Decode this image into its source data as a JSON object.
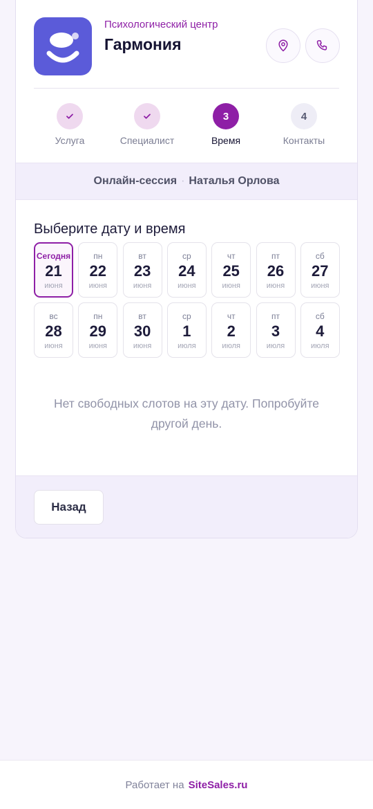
{
  "header": {
    "subtitle": "Психологический центр",
    "title": "Гармония",
    "location_icon": "map-pin-icon",
    "phone_icon": "phone-icon"
  },
  "steps": [
    {
      "label": "Услуга",
      "state": "done"
    },
    {
      "label": "Специалист",
      "state": "done"
    },
    {
      "label": "Время",
      "number": "3",
      "state": "active"
    },
    {
      "label": "Контакты",
      "number": "4",
      "state": "todo"
    }
  ],
  "summary": {
    "service": "Онлайн-сессия",
    "separator": "·",
    "specialist": "Наталья Орлова"
  },
  "section_title": "Выберите дату и время",
  "days": [
    {
      "weekday": "Сегодня",
      "day": "21",
      "month": "июня",
      "selected": true
    },
    {
      "weekday": "пн",
      "day": "22",
      "month": "июня"
    },
    {
      "weekday": "вт",
      "day": "23",
      "month": "июня"
    },
    {
      "weekday": "ср",
      "day": "24",
      "month": "июня"
    },
    {
      "weekday": "чт",
      "day": "25",
      "month": "июня"
    },
    {
      "weekday": "пт",
      "day": "26",
      "month": "июня"
    },
    {
      "weekday": "сб",
      "day": "27",
      "month": "июня"
    },
    {
      "weekday": "вс",
      "day": "28",
      "month": "июня"
    },
    {
      "weekday": "пн",
      "day": "29",
      "month": "июня"
    },
    {
      "weekday": "вт",
      "day": "30",
      "month": "июня"
    },
    {
      "weekday": "ср",
      "day": "1",
      "month": "июля"
    },
    {
      "weekday": "чт",
      "day": "2",
      "month": "июля"
    },
    {
      "weekday": "пт",
      "day": "3",
      "month": "июля"
    },
    {
      "weekday": "сб",
      "day": "4",
      "month": "июля"
    }
  ],
  "empty_message": "Нет свободных слотов на эту дату. Попробуйте другой день.",
  "back_label": "Назад",
  "footer": {
    "prefix": "Работает на",
    "brand": "SiteSales.ru"
  },
  "colors": {
    "accent": "#8e1fa6",
    "logo_bg": "#5b5bd9",
    "page_bg": "#f7f4fc"
  }
}
